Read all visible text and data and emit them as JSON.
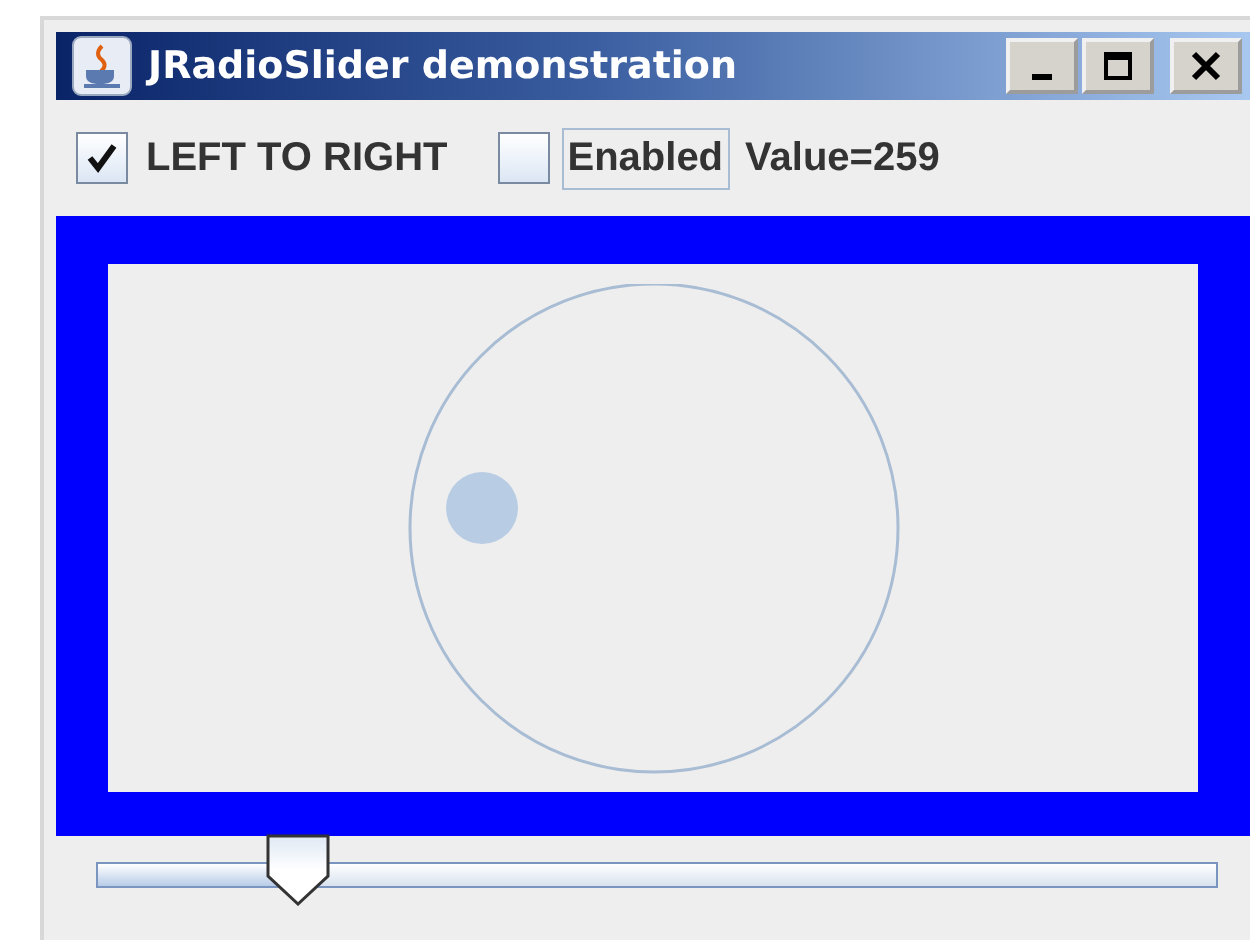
{
  "window": {
    "title": "JRadioSlider demonstration"
  },
  "options": [
    {
      "label": "LEFT TO RIGHT",
      "checked": true,
      "focused": false
    },
    {
      "label": "Enabled",
      "checked": false,
      "focused": true
    }
  ],
  "value_label": "Value=259",
  "slider": {
    "level": 0.18
  }
}
